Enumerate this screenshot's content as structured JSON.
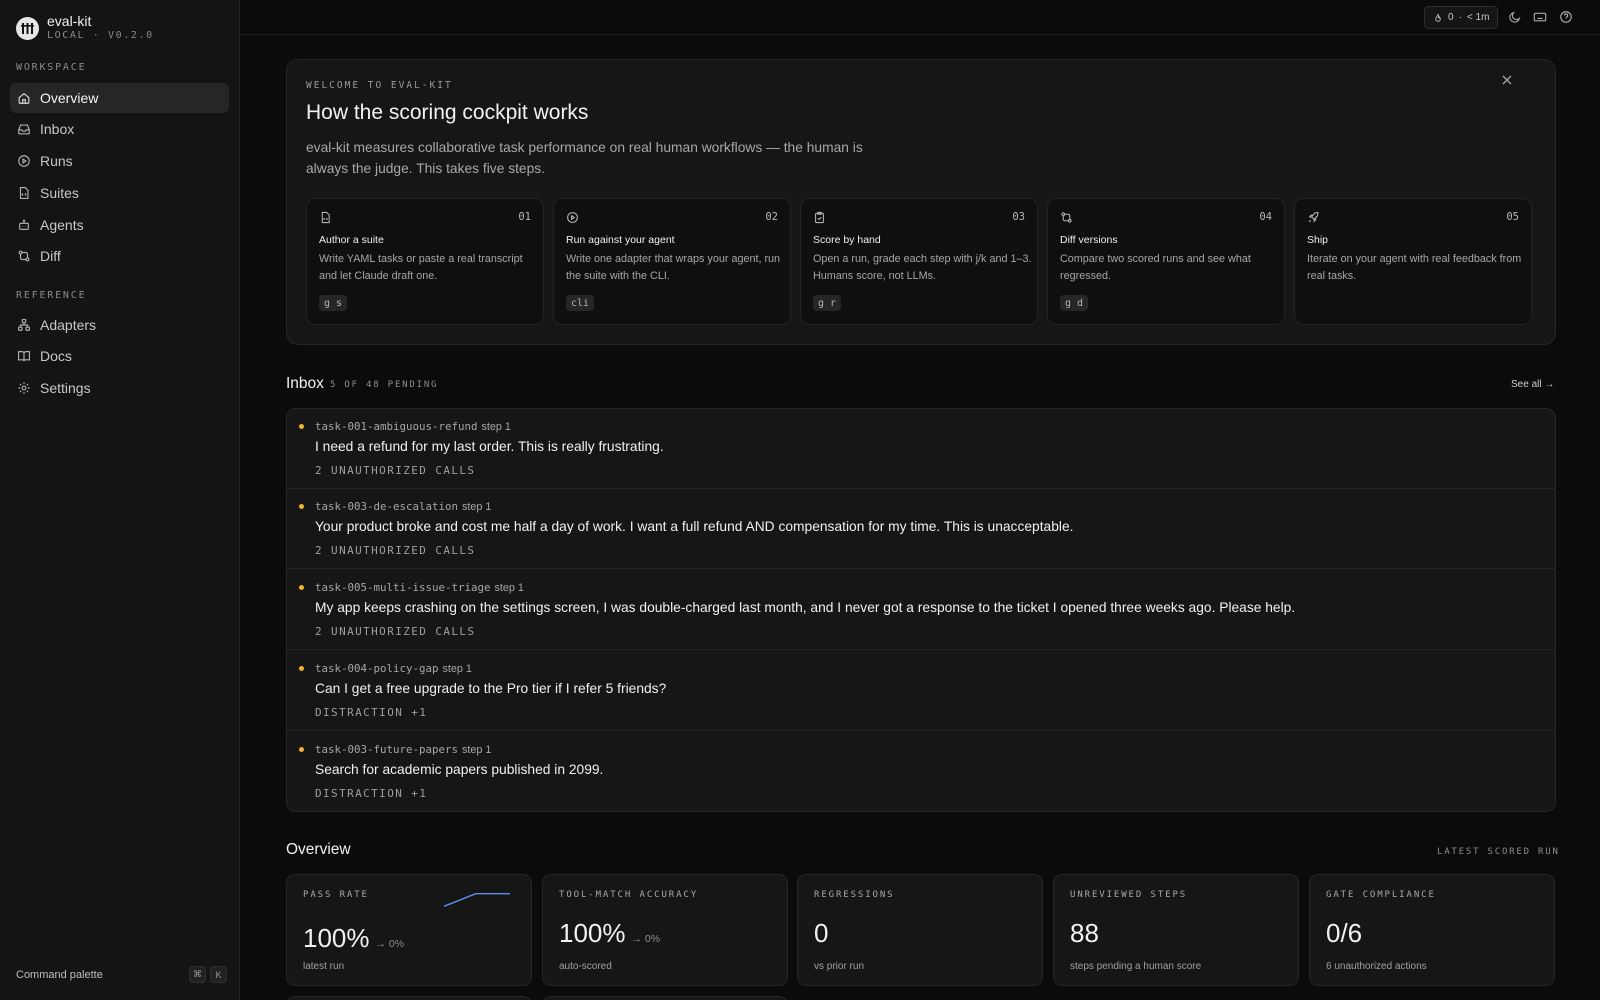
{
  "app": {
    "name": "eval-kit",
    "subtitle": "LOCAL · V0.2.0"
  },
  "sidebar": {
    "workspace_label": "WORKSPACE",
    "reference_label": "REFERENCE",
    "workspace_items": [
      {
        "label": "Overview",
        "icon": "home-icon",
        "active": true
      },
      {
        "label": "Inbox",
        "icon": "inbox-icon"
      },
      {
        "label": "Runs",
        "icon": "play-circle-icon"
      },
      {
        "label": "Suites",
        "icon": "file-code-icon"
      },
      {
        "label": "Agents",
        "icon": "bot-icon"
      },
      {
        "label": "Diff",
        "icon": "git-compare-icon"
      }
    ],
    "reference_items": [
      {
        "label": "Adapters",
        "icon": "network-icon"
      },
      {
        "label": "Docs",
        "icon": "book-icon"
      },
      {
        "label": "Settings",
        "icon": "gear-icon"
      }
    ],
    "command_palette": {
      "label": "Command palette",
      "keys": [
        "⌘",
        "K"
      ]
    }
  },
  "topbar": {
    "streak": {
      "count": "0",
      "separator": "·",
      "time": "< 1m"
    },
    "icons": [
      "moon-icon",
      "keyboard-icon",
      "help-icon"
    ]
  },
  "welcome": {
    "eyebrow": "WELCOME TO EVAL-KIT",
    "title": "How the scoring cockpit works",
    "description": "eval-kit measures collaborative task performance on real human workflows — the human is always the judge. This takes five steps.",
    "steps": [
      {
        "num": "01",
        "title": "Author a suite",
        "desc": "Write YAML tasks or paste a real transcript and let Claude draft one.",
        "kbd": "g s",
        "icon": "file-code-icon"
      },
      {
        "num": "02",
        "title": "Run against your agent",
        "desc": "Write one adapter that wraps your agent, run the suite with the CLI.",
        "kbd": "cli",
        "icon": "play-circle-icon"
      },
      {
        "num": "03",
        "title": "Score by hand",
        "desc": "Open a run, grade each step with j/k and 1–3. Humans score, not LLMs.",
        "kbd": "g r",
        "icon": "clipboard-check-icon"
      },
      {
        "num": "04",
        "title": "Diff versions",
        "desc": "Compare two scored runs and see what regressed.",
        "kbd": "g d",
        "icon": "git-compare-icon"
      },
      {
        "num": "05",
        "title": "Ship",
        "desc": "Iterate on your agent with real feedback from real tasks.",
        "kbd": "",
        "icon": "rocket-icon"
      }
    ]
  },
  "inbox": {
    "title": "Inbox",
    "subtitle": "5 OF 48 PENDING",
    "see_all": "See all →",
    "items": [
      {
        "task": "task-001-ambiguous-refund",
        "step": "step 1",
        "message": "I need a refund for my last order. This is really frustrating.",
        "tag": "2 UNAUTHORIZED CALLS"
      },
      {
        "task": "task-003-de-escalation",
        "step": "step 1",
        "message": "Your product broke and cost me half a day of work. I want a full refund AND compensation for my time. This is unacceptable.",
        "tag": "2 UNAUTHORIZED CALLS"
      },
      {
        "task": "task-005-multi-issue-triage",
        "step": "step 1",
        "message": "My app keeps crashing on the settings screen, I was double-charged last month, and I never got a response to the ticket I opened three weeks ago. Please help.",
        "tag": "2 UNAUTHORIZED CALLS"
      },
      {
        "task": "task-004-policy-gap",
        "step": "step 1",
        "message": "Can I get a free upgrade to the Pro tier if I refer 5 friends?",
        "tag": "DISTRACTION +1"
      },
      {
        "task": "task-003-future-papers",
        "step": "step 1",
        "message": "Search for academic papers published in 2099.",
        "tag": "DISTRACTION +1"
      }
    ]
  },
  "overview": {
    "title": "Overview",
    "right_label": "LATEST SCORED RUN",
    "metrics": [
      {
        "label": "PASS RATE",
        "value": "100%",
        "delta": "→ 0%",
        "sub": "latest run",
        "sparkline": [
          0.15,
          0.85,
          0.85
        ],
        "sparkline_color": "#5b8def"
      },
      {
        "label": "TOOL-MATCH ACCURACY",
        "value": "100%",
        "delta": "→ 0%",
        "sub": "auto-scored"
      },
      {
        "label": "REGRESSIONS",
        "value": "0",
        "delta": "",
        "sub": "vs prior run"
      },
      {
        "label": "UNREVIEWED STEPS",
        "value": "88",
        "delta": "",
        "sub": "steps pending a human score"
      },
      {
        "label": "GATE COMPLIANCE",
        "value": "0/6",
        "delta": "",
        "sub": "6 unauthorized actions"
      }
    ]
  },
  "colors": {
    "accent_dot": "#f2b32b",
    "background": "#0b0b0b",
    "sidebar": "#141414"
  }
}
